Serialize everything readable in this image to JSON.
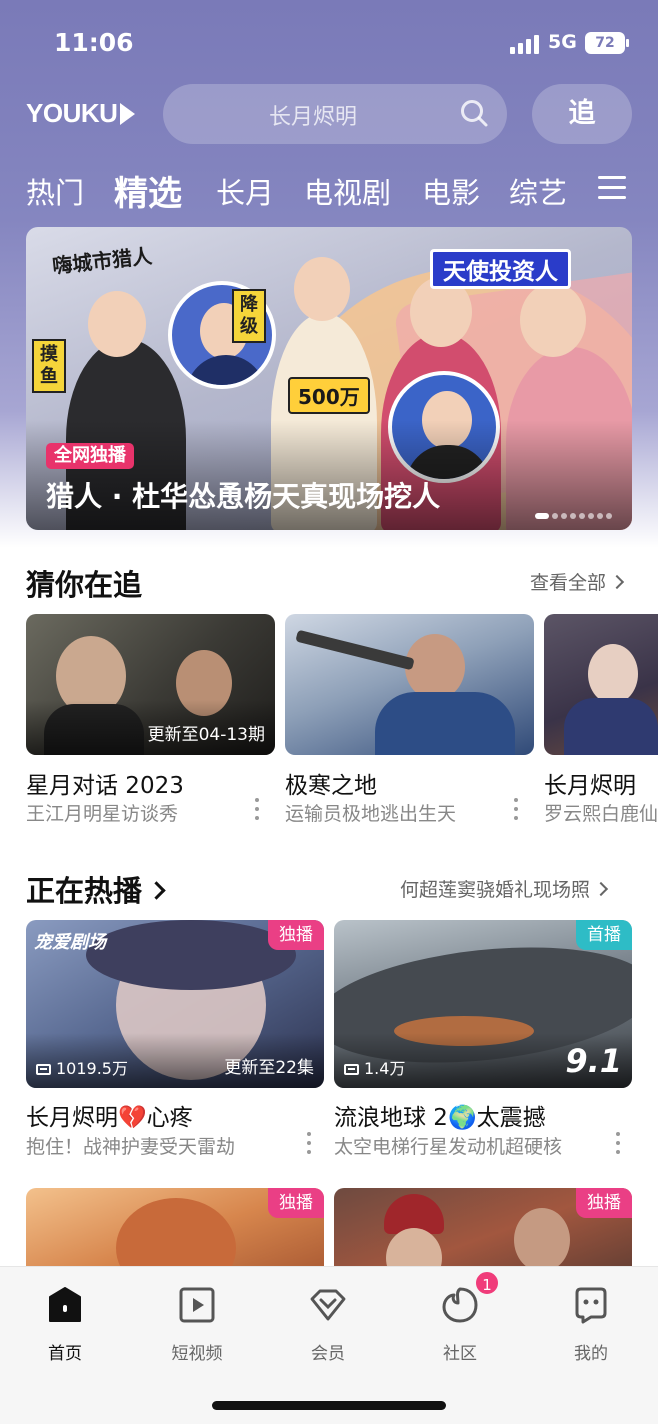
{
  "status_bar": {
    "time": "11:06",
    "network": "5G",
    "battery": "72"
  },
  "header": {
    "logo": "YOUKU",
    "search_placeholder": "长月烬明",
    "follow_button": "追"
  },
  "tabs": [
    "热门",
    "精选",
    "长月",
    "电视剧",
    "电影",
    "综艺"
  ],
  "active_tab": "精选",
  "banner": {
    "tag": "全网独播",
    "title": "猎人 · 杜华怂恿杨天真现场挖人",
    "show_logo": "嗨城市猎人",
    "labels": {
      "fish": "摸鱼",
      "downgrade": "降级",
      "angel": "天使投资人",
      "amount": "500万"
    },
    "dot_count": 8,
    "active_dot": 0
  },
  "section1": {
    "title": "猜你在追",
    "link": "查看全部",
    "cards": [
      {
        "title": "星月对话 2023",
        "subtitle": "王江月明星访谈秀",
        "caption": "更新至04-13期"
      },
      {
        "title": "极寒之地",
        "subtitle": "运输员极地逃出生天",
        "caption": ""
      },
      {
        "title": "长月烬明",
        "subtitle": "罗云熙白鹿仙",
        "caption": ""
      }
    ]
  },
  "section2": {
    "title": "正在热播",
    "link": "何超莲窦骁婚礼现场照",
    "cards": [
      {
        "title": "长月烬明💔心疼",
        "subtitle": "抱住！战神护妻受天雷劫",
        "badge": "独播",
        "badge_color": "#ea3f85",
        "views": "1019.5万",
        "update": "更新至22集",
        "logo": "宠爱剧场"
      },
      {
        "title": "流浪地球 2🌍太震撼",
        "subtitle": "太空电梯行星发动机超硬核",
        "badge": "首播",
        "badge_color": "#2ebcc6",
        "views": "1.4万",
        "score": "9.1"
      }
    ],
    "row2_badges": [
      "独播",
      "独播"
    ]
  },
  "bottom_nav": {
    "items": [
      {
        "label": "首页",
        "icon": "home-icon"
      },
      {
        "label": "短视频",
        "icon": "short-video-icon"
      },
      {
        "label": "会员",
        "icon": "vip-icon"
      },
      {
        "label": "社区",
        "icon": "community-icon"
      },
      {
        "label": "我的",
        "icon": "profile-icon"
      }
    ],
    "active": "首页",
    "community_badge": "1"
  },
  "colors": {
    "header": "#7a7ab8",
    "accent_pink": "#ea3f85",
    "accent_teal": "#2ebcc6"
  }
}
